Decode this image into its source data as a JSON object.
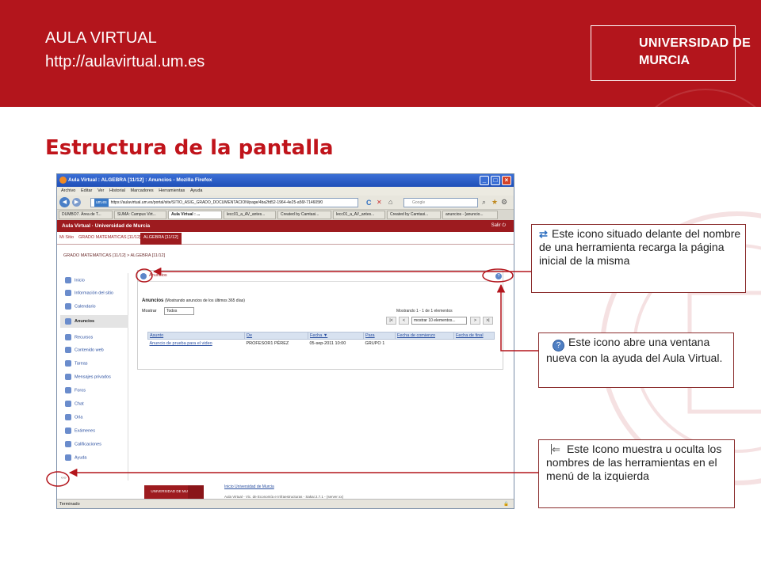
{
  "slide": {
    "header_line1": "AULA VIRTUAL",
    "header_line2": "http://aulavirtual.um.es",
    "university_line1": "UNIVERSIDAD DE",
    "university_line2": "MURCIA",
    "title": "Estructura de la pantalla"
  },
  "browser": {
    "window_title": "Aula Virtual : ALGEBRA [11/12] : Anuncios - Mozilla Firefox",
    "window_buttons": [
      "_",
      "□",
      "×"
    ],
    "menu": [
      "Archivo",
      "Editar",
      "Ver",
      "Historial",
      "Marcadores",
      "Herramientas",
      "Ayuda"
    ],
    "url_badge": "um.es",
    "url": "https://aulavirtual.um.es/portal/site/SITIO_ASIG_GRADO_DOCUMENTACION/page/4ba2fd52-1964-4e25-a56f-714605f0",
    "search_placeholder": "Google",
    "tabs": [
      {
        "label": "DUMBO7. Área de T..."
      },
      {
        "label": "SUMA: Campus Virt..."
      },
      {
        "label": "Aula Virtual : ..."
      },
      {
        "label": "lecc01_a_AV_antes..."
      },
      {
        "label": "Created by Camtasi..."
      },
      {
        "label": "lecc01_a_AV_antes..."
      },
      {
        "label": "Created by Camtasi..."
      },
      {
        "label": "anuncios - [anuncio..."
      }
    ],
    "status": "Terminado"
  },
  "app": {
    "brand": "Aula Virtual · Universidad de Murcia",
    "logout": "Salir",
    "site_tabs": [
      "Mi Sitio",
      "GRADO MATEMATICAS [11/12]",
      "ALGEBRA [11/12]"
    ],
    "breadcrumb": "GRADO MATEMATICAS [11/12] > ALGEBRA [11/12]",
    "menu": [
      "Inicio",
      "Información del sitio",
      "Calendario",
      "Anuncios",
      "Recursos",
      "Contenido web",
      "Tareas",
      "Mensajes privados",
      "Foros",
      "Chat",
      "Orla",
      "Exámenes",
      "Calificaciones",
      "Ayuda"
    ],
    "toggle_tools": "‹‹‹›",
    "tool": {
      "title": "Anuncios",
      "help_icon": "?",
      "subtitle": "Anuncios",
      "subtitle_note": "(Mostrando anuncios de los últimos 365 días)",
      "show_label": "Mostrar",
      "show_value": "Todos",
      "count": "Mostrando 1 - 1 de 1 elementos",
      "pager_first": "|<",
      "pager_prev": "<",
      "pager_size": "mostrar 10 elementos...",
      "pager_next": ">",
      "pager_last": ">|",
      "columns": [
        "Asunto",
        "De",
        "Fecha ▼",
        "Para",
        "Fecha de comienzo",
        "Fecha de final"
      ],
      "rows": [
        {
          "asunto": "Anuncio de prueba para el video",
          "de": "PROFESOR1 PÉREZ",
          "fecha": "05-sep-2011 10:00",
          "para": "GRUPO 1",
          "comienzo": "",
          "final": ""
        }
      ]
    },
    "footer_logo": "UNIVERSIDAD DE MURCIA",
    "footer_links": "Inicio   Universidad de Murcia",
    "footer_info": "Aula Virtual - Vic. de Economía e Infraestructuras - Sakai 2.7.1 - (server xx)"
  },
  "callouts": {
    "reload": "Este icono situado delante del nombre de una herramienta recarga la página inicial de la misma",
    "help": "Este icono abre una ventana nueva con la ayuda del Aula Virtual.",
    "toggle": "Este Icono muestra u oculta los nombres de las herramientas en el menú de la izquierda"
  },
  "colors": {
    "brand_red": "#b3151c",
    "title_red": "#c0141b",
    "arrow_red": "#b3151c"
  }
}
